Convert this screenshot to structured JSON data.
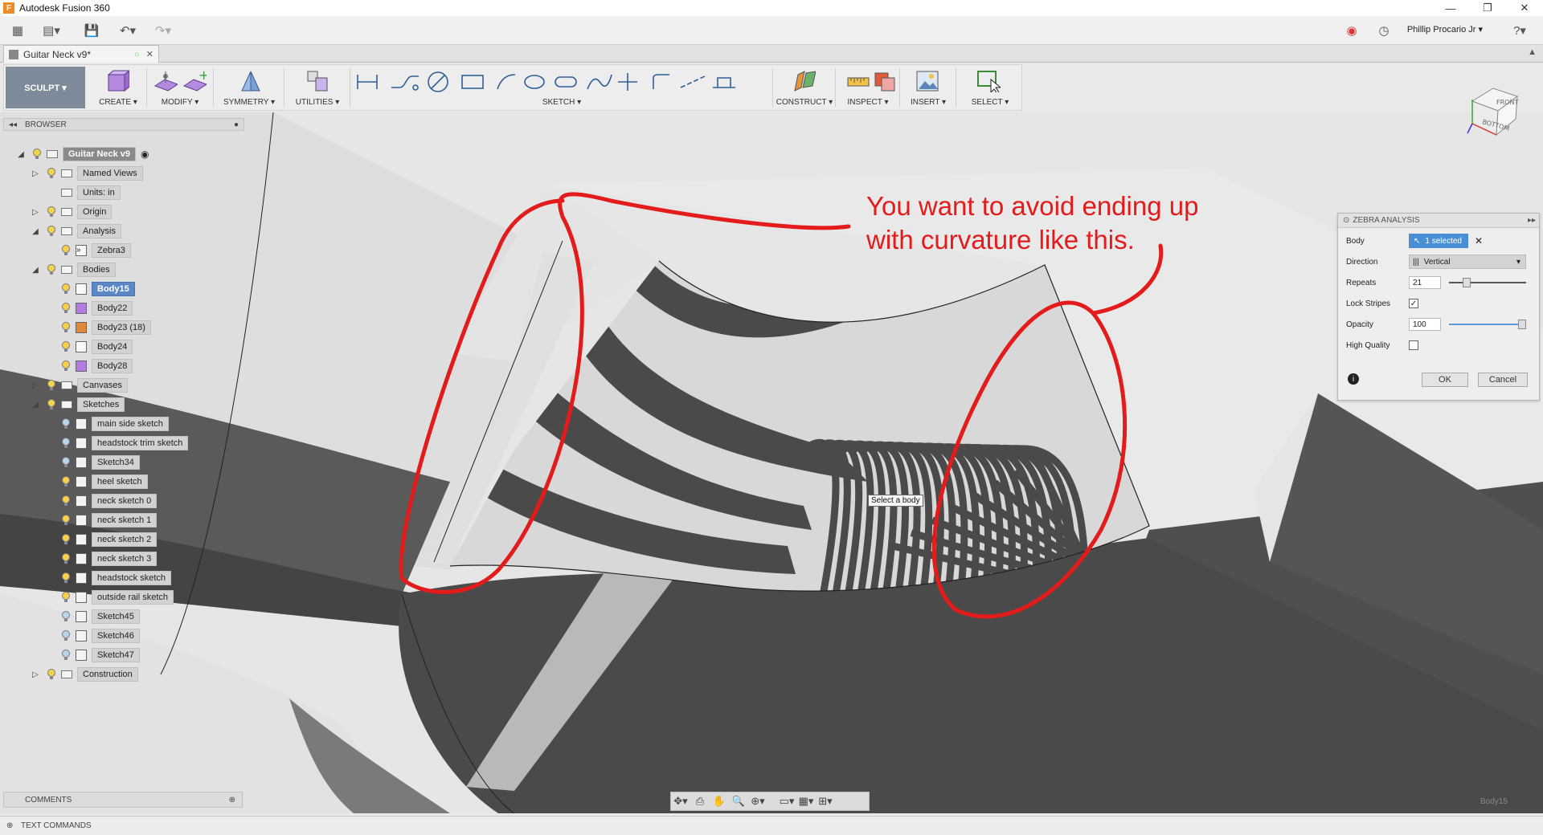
{
  "app": {
    "title": "Autodesk Fusion 360",
    "icon": "F"
  },
  "window_controls": {
    "minimize": "—",
    "restore": "❐",
    "close": "✕"
  },
  "quick_access": {
    "user": "Phillip Procario Jr ▾",
    "help": "?▾"
  },
  "document_tab": {
    "name": "Guitar Neck v9*"
  },
  "toolbar": {
    "workspace": "SCULPT ▾",
    "groups": [
      {
        "label": "CREATE ▾"
      },
      {
        "label": "MODIFY ▾"
      },
      {
        "label": "SYMMETRY ▾"
      },
      {
        "label": "UTILITIES ▾"
      },
      {
        "label": "SKETCH ▾"
      },
      {
        "label": "CONSTRUCT ▾"
      },
      {
        "label": "INSPECT ▾"
      },
      {
        "label": "INSERT ▾"
      },
      {
        "label": "SELECT ▾"
      }
    ]
  },
  "browser": {
    "title": "BROWSER",
    "root": "Guitar Neck v9",
    "items": [
      {
        "label": "Named Views"
      },
      {
        "label": "Units: in"
      },
      {
        "label": "Origin"
      },
      {
        "label": "Analysis"
      },
      {
        "label": "Zebra3"
      },
      {
        "label": "Bodies"
      },
      {
        "label": "Body15"
      },
      {
        "label": "Body22"
      },
      {
        "label": "Body23 (18)"
      },
      {
        "label": "Body24"
      },
      {
        "label": "Body28"
      },
      {
        "label": "Canvases"
      },
      {
        "label": "Sketches"
      },
      {
        "label": "main side sketch"
      },
      {
        "label": "headstock trim sketch"
      },
      {
        "label": "Sketch34"
      },
      {
        "label": "heel sketch"
      },
      {
        "label": "neck sketch 0"
      },
      {
        "label": "neck sketch 1"
      },
      {
        "label": "neck sketch 2"
      },
      {
        "label": "neck sketch 3"
      },
      {
        "label": "headstock sketch"
      },
      {
        "label": "outside rail sketch"
      },
      {
        "label": "Sketch45"
      },
      {
        "label": "Sketch46"
      },
      {
        "label": "Sketch47"
      },
      {
        "label": "Construction"
      }
    ]
  },
  "zebra_panel": {
    "title": "ZEBRA ANALYSIS",
    "body_label": "Body",
    "body_value": "1 selected",
    "direction_label": "Direction",
    "direction_value": "Vertical",
    "repeats_label": "Repeats",
    "repeats_value": "21",
    "repeats_fraction": 0.2,
    "lock_label": "Lock Stripes",
    "lock_checked": true,
    "opacity_label": "Opacity",
    "opacity_value": "100",
    "opacity_fraction": 1.0,
    "quality_label": "High Quality",
    "quality_checked": false,
    "ok": "OK",
    "cancel": "Cancel"
  },
  "viewport": {
    "tooltip": "Select a body",
    "annotation_line1": "You want to avoid ending up",
    "annotation_line2": "with curvature like this.",
    "annotation_color": "#e31b1b",
    "active_body": "Body15"
  },
  "viewcube": {
    "front": "FRONT",
    "bottom": "BOTTOM"
  },
  "panels": {
    "comments": "COMMENTS",
    "text_commands": "TEXT COMMANDS"
  }
}
